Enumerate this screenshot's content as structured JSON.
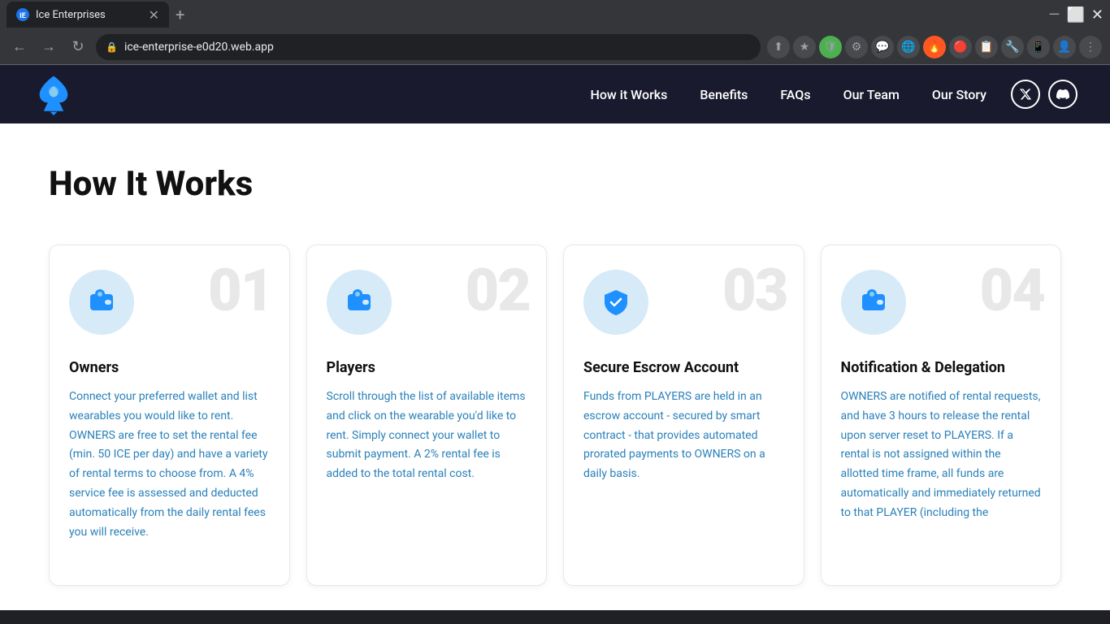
{
  "browser": {
    "tab_title": "Ice Enterprises",
    "url": "ice-enterprise-e0d20.web.app",
    "new_tab_symbol": "+",
    "nav_back": "←",
    "nav_forward": "→",
    "nav_refresh": "↻"
  },
  "navbar": {
    "logo_alt": "Ice Enterprises logo",
    "links": [
      {
        "label": "How it Works",
        "id": "how-it-works"
      },
      {
        "label": "Benefits",
        "id": "benefits"
      },
      {
        "label": "FAQs",
        "id": "faqs"
      },
      {
        "label": "Our Team",
        "id": "our-team"
      },
      {
        "label": "Our Story",
        "id": "our-story"
      }
    ],
    "social": [
      {
        "name": "twitter",
        "icon": "𝕏"
      },
      {
        "name": "discord",
        "icon": "💬"
      }
    ]
  },
  "page": {
    "title": "How It Works",
    "cards": [
      {
        "number": "01",
        "title": "Owners",
        "icon_name": "wallet-icon",
        "body_black": "",
        "body": "Connect your preferred wallet and list wearables you would like to rent. OWNERS are free to set the rental fee (min. 50 ICE per day) and have a variety of rental terms to choose from. A 4% service fee is assessed and deducted automatically from the daily rental fees you will receive."
      },
      {
        "number": "02",
        "title": "Players",
        "icon_name": "wallet-icon",
        "body_black": "",
        "body": "Scroll through the list of available items and click on the wearable you'd like to rent. Simply connect your wallet to submit payment. A 2% rental fee is added to the total rental cost."
      },
      {
        "number": "03",
        "title": "Secure Escrow Account",
        "icon_name": "shield-check-icon",
        "body_black": "",
        "body": "Funds from PLAYERS are held in an escrow account - secured by smart contract - that provides automated prorated payments to OWNERS on a daily basis."
      },
      {
        "number": "04",
        "title": "Notification & Delegation",
        "icon_name": "wallet-icon",
        "body_black": "",
        "body": "OWNERS are notified of rental requests, and have 3 hours to release the rental upon server reset to PLAYERS. If a rental is not assigned within the allotted time frame, all funds are automatically and immediately returned to that PLAYER (including the"
      }
    ]
  }
}
